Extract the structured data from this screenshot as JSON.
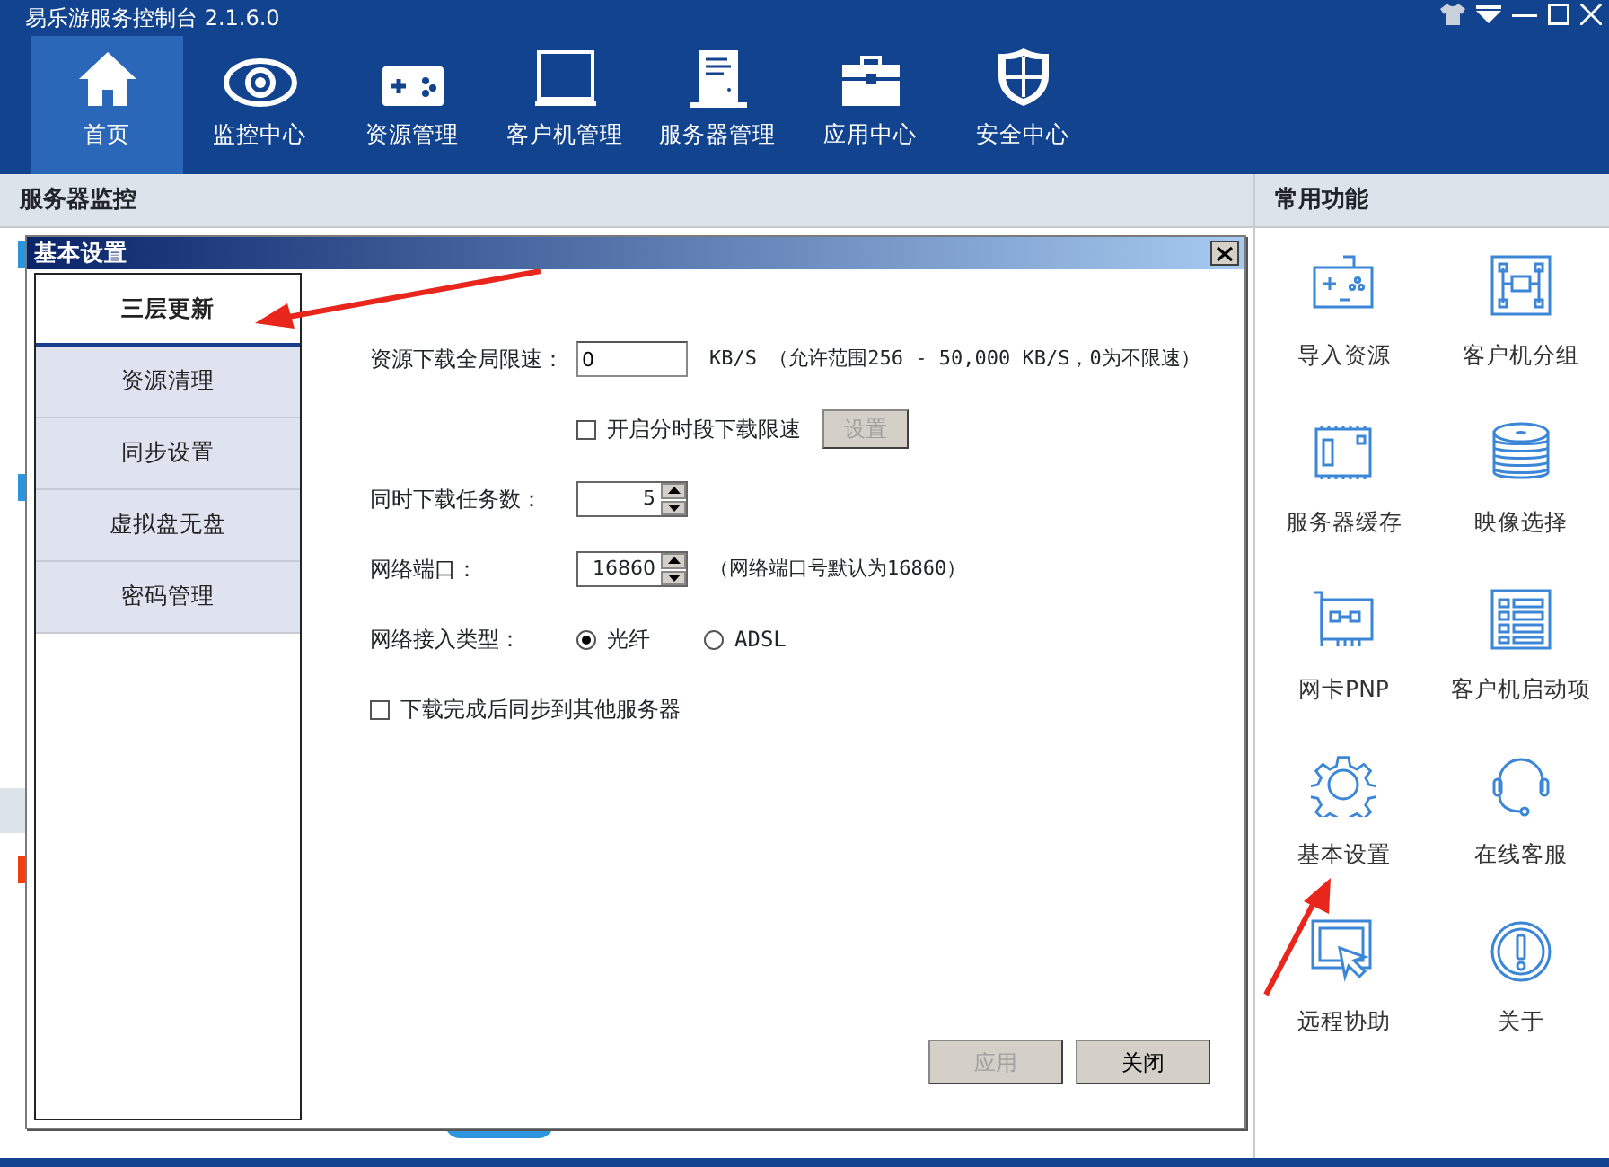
{
  "app": {
    "title": "易乐游服务控制台 2.1.6.0"
  },
  "nav": [
    {
      "label": "首页",
      "selected": true
    },
    {
      "label": "监控中心",
      "selected": false
    },
    {
      "label": "资源管理",
      "selected": false
    },
    {
      "label": "客户机管理",
      "selected": false
    },
    {
      "label": "服务器管理",
      "selected": false
    },
    {
      "label": "应用中心",
      "selected": false
    },
    {
      "label": "安全中心",
      "selected": false
    }
  ],
  "left_panel": {
    "title": "服务器监控"
  },
  "right_panel": {
    "title": "常用功能",
    "items": [
      {
        "label": "导入资源"
      },
      {
        "label": "客户机分组"
      },
      {
        "label": "服务器缓存"
      },
      {
        "label": "映像选择"
      },
      {
        "label": "网卡PNP"
      },
      {
        "label": "客户机启动项"
      },
      {
        "label": "基本设置"
      },
      {
        "label": "在线客服"
      },
      {
        "label": "远程协助"
      },
      {
        "label": "关于"
      }
    ]
  },
  "dialog": {
    "title": "基本设置",
    "tabs": [
      {
        "label": "三层更新",
        "selected": true
      },
      {
        "label": "资源清理",
        "selected": false
      },
      {
        "label": "同步设置",
        "selected": false
      },
      {
        "label": "虚拟盘无盘",
        "selected": false
      },
      {
        "label": "密码管理",
        "selected": false
      }
    ],
    "rows": [
      {
        "kind": "text",
        "label": "资源下载全局限速：",
        "value": "0",
        "note": "KB/S （允许范围256 - 50,000 KB/S，0为不限速）"
      },
      {
        "kind": "checkbox_button",
        "label": "开启分时段下载限速",
        "checked": false,
        "button": {
          "label": "设置",
          "disabled": true
        }
      },
      {
        "kind": "spin",
        "label": "同时下载任务数：",
        "value": "5"
      },
      {
        "kind": "spin",
        "label": "网络端口：",
        "value": "16860",
        "note": "（网络端口号默认为16860）"
      },
      {
        "kind": "radio",
        "label": "网络接入类型：",
        "options": [
          {
            "label": "光纤",
            "selected": true
          },
          {
            "label": "ADSL",
            "selected": false
          }
        ]
      },
      {
        "kind": "checkbox",
        "label": "下载完成后同步到其他服务器",
        "checked": false
      }
    ],
    "buttons": [
      {
        "label": "应用",
        "disabled": true
      },
      {
        "label": "关闭",
        "disabled": false
      }
    ]
  }
}
